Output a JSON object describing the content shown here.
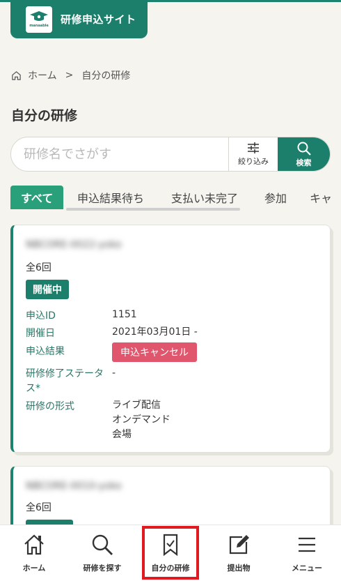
{
  "header": {
    "site_title": "研修申込サイト",
    "logo_text": "manaable"
  },
  "breadcrumb": {
    "home": "ホーム",
    "separator": ">",
    "current": "自分の研修"
  },
  "page_title": "自分の研修",
  "search": {
    "placeholder": "研修名でさがす",
    "value": "",
    "filter_label": "絞り込み",
    "search_label": "検索"
  },
  "tabs": [
    {
      "label": "すべて",
      "active": true
    },
    {
      "label": "申込結果待ち",
      "active": false
    },
    {
      "label": "支払い未完了",
      "active": false
    },
    {
      "label": "参加",
      "active": false
    },
    {
      "label": "キャ",
      "active": false
    }
  ],
  "cards": [
    {
      "name": "NBCORE-0022-yoko",
      "sessions": "全6回",
      "status_badge": "開催中",
      "fields": {
        "application_id_label": "申込ID",
        "application_id": "1151",
        "date_label": "開催日",
        "date": "2021年03月01日 -",
        "result_label": "申込結果",
        "result": "申込キャンセル",
        "completion_label": "研修修了ステータス*",
        "completion": "-",
        "format_label": "研修の形式",
        "formats": [
          "ライブ配信",
          "オンデマンド",
          "会場"
        ]
      }
    },
    {
      "name": "NBCORE-0010-yoko",
      "sessions": "全6回"
    }
  ],
  "bottom_nav": [
    {
      "label": "ホーム",
      "icon": "home-icon"
    },
    {
      "label": "研修を探す",
      "icon": "search-icon"
    },
    {
      "label": "自分の研修",
      "icon": "bookmark-check-icon",
      "highlighted": true
    },
    {
      "label": "提出物",
      "icon": "edit-icon"
    },
    {
      "label": "メニュー",
      "icon": "menu-icon"
    }
  ],
  "colors": {
    "brand": "#1c7f6c",
    "tab_active": "#2aa07a",
    "cancel": "#e0566c",
    "highlight_box": "#e11a22"
  }
}
